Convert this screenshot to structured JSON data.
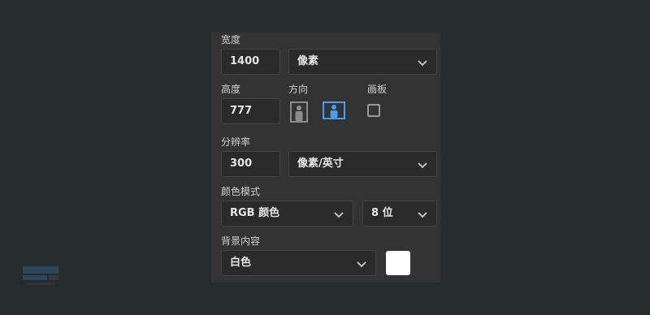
{
  "width": {
    "label": "宽度",
    "value": "1400",
    "unit": "像素"
  },
  "height": {
    "label": "高度",
    "value": "777"
  },
  "orientation": {
    "label": "方向",
    "selected": "landscape",
    "icons": [
      "portrait-icon",
      "landscape-icon"
    ]
  },
  "artboard": {
    "label": "画板",
    "checked": false
  },
  "resolution": {
    "label": "分辨率",
    "value": "300",
    "unit": "像素/英寸"
  },
  "color_mode": {
    "label": "颜色模式",
    "mode": "RGB 颜色",
    "depth": "8 位"
  },
  "background": {
    "label": "背景内容",
    "value": "白色",
    "swatch_color": "#ffffff"
  },
  "colors": {
    "accent": "#4a9ee8",
    "panel": "#333333",
    "field": "#2a2a2a",
    "page": "#262b2e"
  }
}
